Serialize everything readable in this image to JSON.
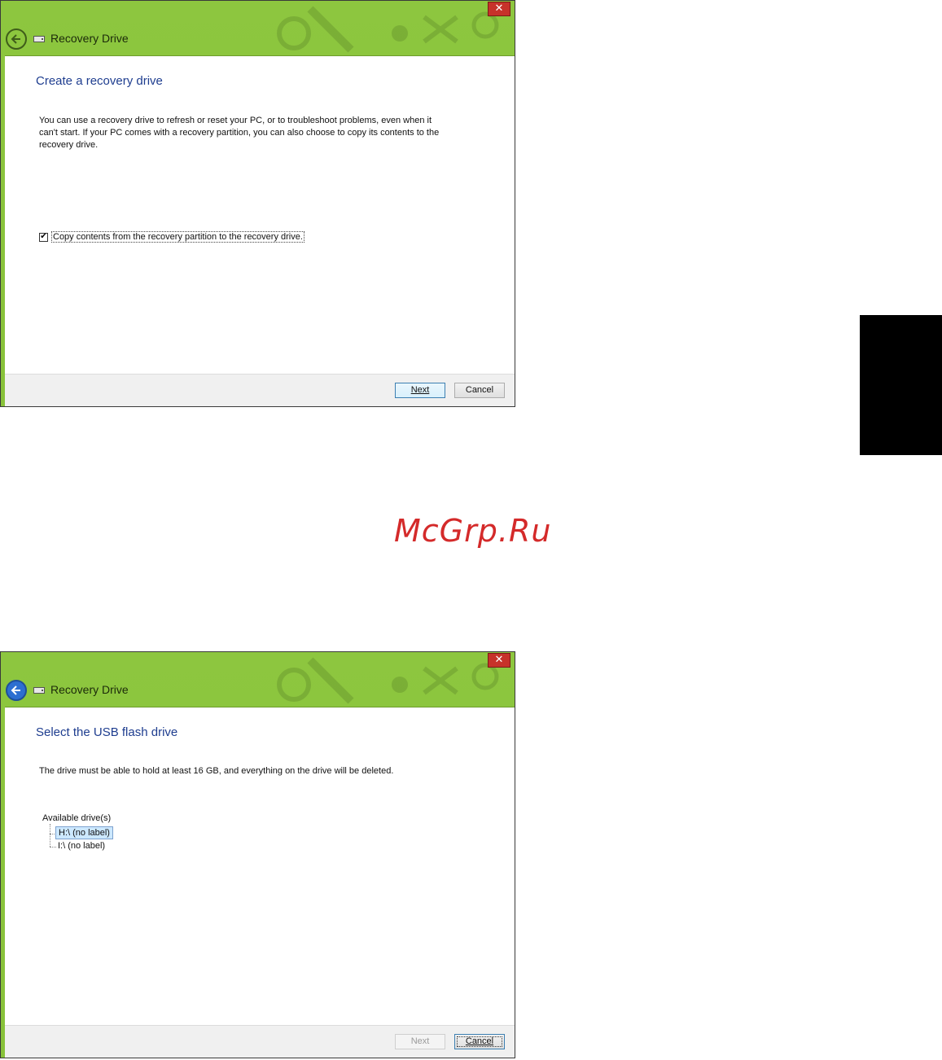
{
  "window1": {
    "title": "Recovery Drive",
    "close_label": "✕",
    "heading": "Create a recovery drive",
    "paragraph": "You can use a recovery drive to refresh or reset your PC, or to troubleshoot problems, even when it can't start. If your PC comes with a recovery partition, you can also choose to copy its contents to the recovery drive.",
    "checkbox_label": "Copy contents from the recovery partition to the recovery drive.",
    "checkbox_checked": true,
    "checkbox_mark": "✔",
    "next_label": "Next",
    "cancel_label": "Cancel"
  },
  "window2": {
    "title": "Recovery Drive",
    "close_label": "✕",
    "heading": "Select the USB flash drive",
    "paragraph": "The drive must be able to hold at least 16 GB, and everything on the drive will be deleted.",
    "tree_root": "Available drive(s)",
    "drives": [
      {
        "label": "H:\\ (no label)",
        "selected": true
      },
      {
        "label": "I:\\ (no label)",
        "selected": false
      }
    ],
    "next_label": "Next",
    "cancel_label": "Cancel"
  },
  "watermark": "McGrp.Ru",
  "colors": {
    "titlebar_green": "#8cc63f",
    "heading_blue": "#1e3d8f",
    "close_red": "#c7322a",
    "watermark_red": "#d42a2a"
  }
}
